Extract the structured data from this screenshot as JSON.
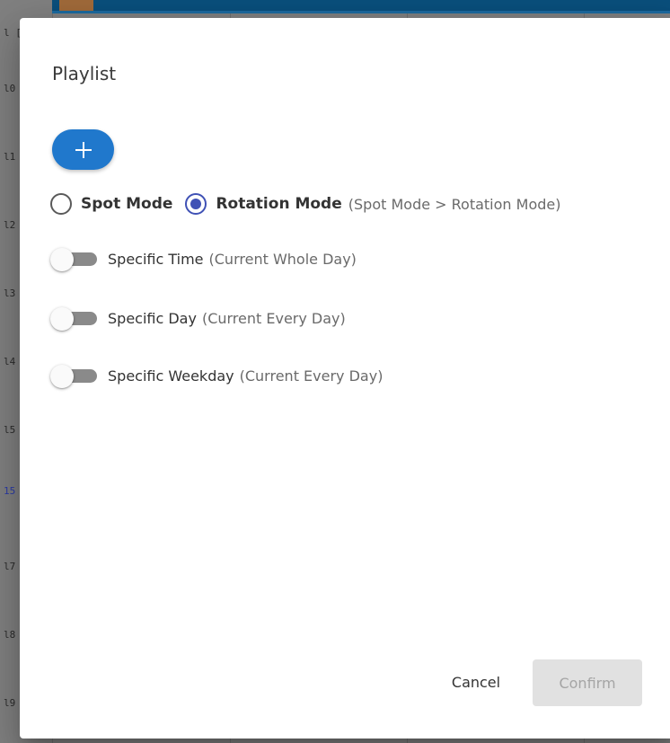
{
  "background": {
    "header_label": "l [",
    "row_labels": [
      "l0",
      "l1",
      "l2",
      "l3",
      "l4",
      "l5",
      "15",
      "l7",
      "l8",
      "l9"
    ]
  },
  "dialog": {
    "title": "Playlist",
    "add_button": {
      "icon": "plus-icon"
    },
    "mode": {
      "options": [
        {
          "label": "Spot Mode",
          "checked": false
        },
        {
          "label": "Rotation Mode",
          "checked": true
        }
      ],
      "hint": "(Spot Mode > Rotation Mode)"
    },
    "toggles": [
      {
        "label": "Specific Time",
        "hint": "(Current Whole Day)",
        "on": false
      },
      {
        "label": "Specific Day",
        "hint": "(Current Every Day)",
        "on": false
      },
      {
        "label": "Specific Weekday",
        "hint": "(Current Every Day)",
        "on": false
      }
    ],
    "actions": {
      "cancel_label": "Cancel",
      "confirm_label": "Confirm",
      "confirm_disabled": true
    }
  },
  "colors": {
    "primary": "#2078cc",
    "radio_checked": "#3f51b5",
    "overlay": "#808080"
  }
}
